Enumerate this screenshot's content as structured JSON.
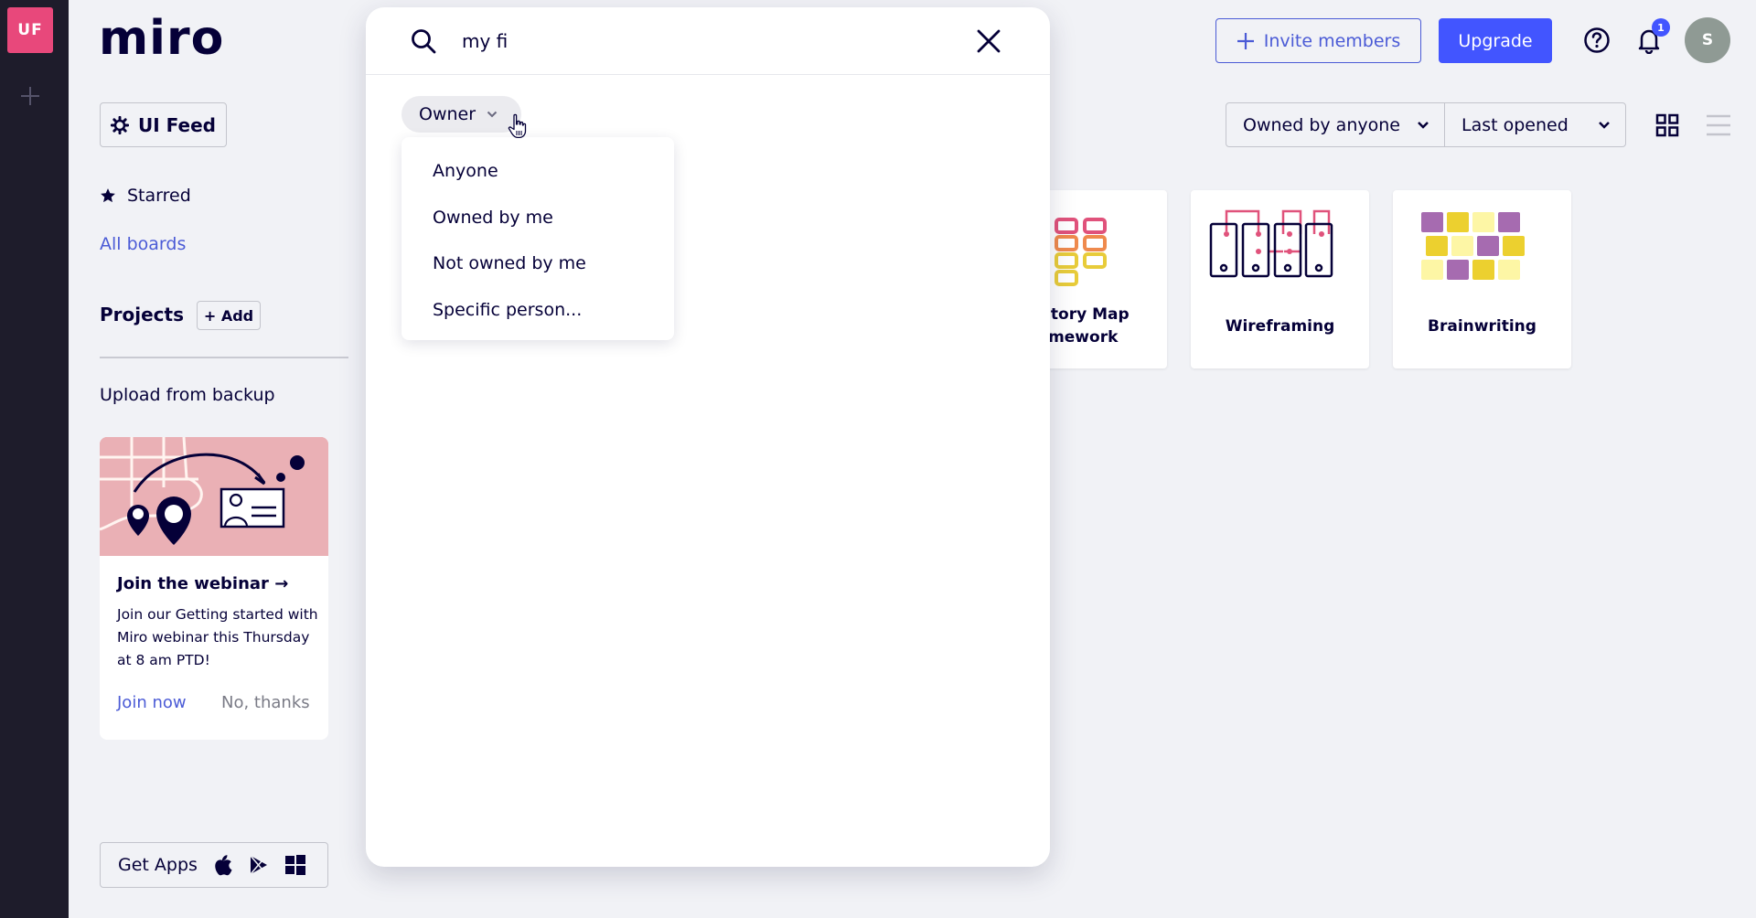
{
  "rail": {
    "team_initials": "UF",
    "team_color": "#e8487b",
    "add_team_icon": "plus-icon"
  },
  "sidebar": {
    "logo": "miro",
    "team_button": {
      "icon": "gear-icon",
      "label": "UI Feed"
    },
    "starred": {
      "icon": "star-icon",
      "label": "Starred"
    },
    "all_boards": "All boards",
    "projects": {
      "label": "Projects",
      "add_label": "+ Add"
    },
    "upload_backup": "Upload from backup",
    "webinar": {
      "title": "Join the webinar →",
      "body": "Join our Getting started with Miro webinar this Thursday at 8 am PTD!",
      "join_label": "Join now",
      "dismiss_label": "No, thanks"
    },
    "get_apps": {
      "label": "Get Apps",
      "icons": [
        "apple-icon",
        "google-play-icon",
        "windows-icon"
      ]
    }
  },
  "header": {
    "invite_label": "Invite members",
    "upgrade_label": "Upgrade",
    "notification_count": "1",
    "avatar_initial": "S",
    "accent_color": "#4255ff"
  },
  "filters": {
    "owner_selected": "Owned by anyone",
    "sort_selected": "Last opened",
    "view_modes": [
      "grid",
      "list"
    ],
    "active_view": "grid"
  },
  "boards": [
    {
      "title_line1": "r Story Map",
      "title_line2": "amework"
    },
    {
      "title": "Wireframing"
    },
    {
      "title": "Brainwriting"
    }
  ],
  "search_modal": {
    "query": "my fi",
    "owner_filter_label": "Owner",
    "owner_options": [
      "Anyone",
      "Owned by me",
      "Not owned by me",
      "Specific person..."
    ]
  }
}
